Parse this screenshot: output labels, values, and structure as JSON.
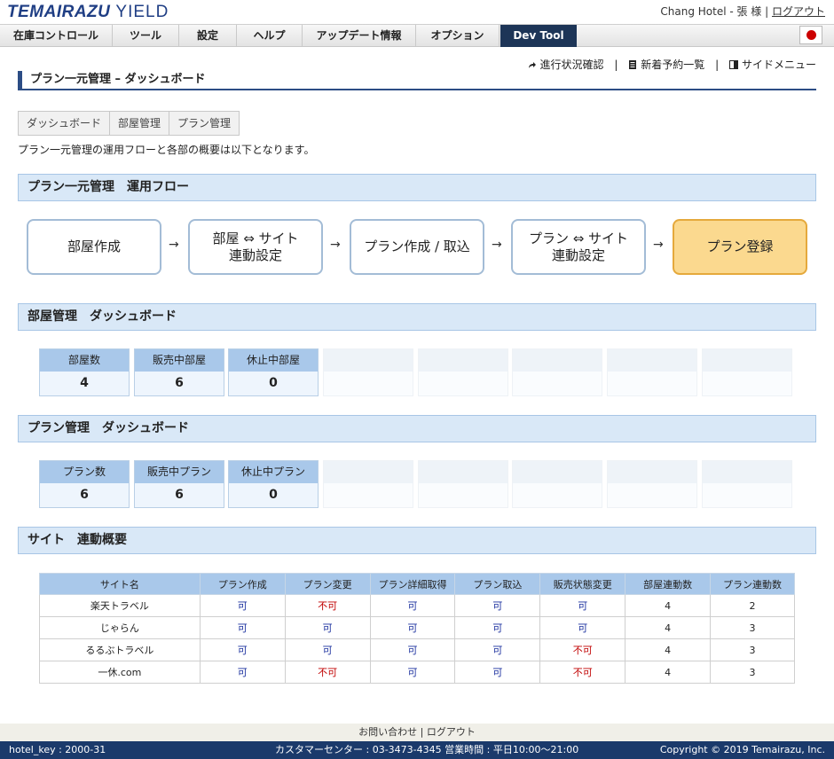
{
  "header": {
    "logo_main": "TEMAIRAZU",
    "logo_sub": "YIELD",
    "user_text": "Chang Hotel - 張 様",
    "logout_label": "ログアウト"
  },
  "nav": {
    "items": [
      "在庫コントロール",
      "ツール",
      "設定",
      "ヘルプ",
      "アップデート情報",
      "オプション",
      "Dev Tool"
    ]
  },
  "toplinks": {
    "progress": "進行状況確認",
    "new_reservations": "新着予約一覧",
    "side_menu": "サイドメニュー"
  },
  "page": {
    "title": "プラン一元管理 – ダッシュボード",
    "tabs": [
      "ダッシュボード",
      "部屋管理",
      "プラン管理"
    ],
    "intro": "プラン一元管理の運用フローと各部の概要は以下となります。"
  },
  "flow": {
    "heading": "プラン一元管理　運用フロー",
    "steps": [
      [
        "部屋作成"
      ],
      [
        "部屋 ⇔ サイト",
        "連動設定"
      ],
      [
        "プラン作成 / 取込"
      ],
      [
        "プラン ⇔ サイト",
        "連動設定"
      ],
      [
        "プラン登録"
      ]
    ],
    "arrow": "→"
  },
  "rooms": {
    "heading": "部屋管理　ダッシュボード",
    "stats": [
      {
        "label": "部屋数",
        "value": "4"
      },
      {
        "label": "販売中部屋",
        "value": "6"
      },
      {
        "label": "休止中部屋",
        "value": "0"
      }
    ]
  },
  "plans": {
    "heading": "プラン管理　ダッシュボード",
    "stats": [
      {
        "label": "プラン数",
        "value": "6"
      },
      {
        "label": "販売中プラン",
        "value": "6"
      },
      {
        "label": "休止中プラン",
        "value": "0"
      }
    ]
  },
  "sites": {
    "heading": "サイト　連動概要",
    "columns": [
      "サイト名",
      "プラン作成",
      "プラン変更",
      "プラン詳細取得",
      "プラン取込",
      "販売状態変更",
      "部屋連動数",
      "プラン連動数"
    ],
    "rows": [
      [
        "楽天トラベル",
        "可",
        "不可",
        "可",
        "可",
        "可",
        "4",
        "2"
      ],
      [
        "じゃらん",
        "可",
        "可",
        "可",
        "可",
        "可",
        "4",
        "3"
      ],
      [
        "るるぶトラベル",
        "可",
        "可",
        "可",
        "可",
        "不可",
        "4",
        "3"
      ],
      [
        "一休.com",
        "可",
        "不可",
        "可",
        "可",
        "不可",
        "4",
        "3"
      ]
    ]
  },
  "footer": {
    "contact": "お問い合わせ",
    "logout": "ログアウト",
    "hotel_key": "hotel_key : 2000-31",
    "center": "カスタマーセンター : 03-3473-4345 営業時間 : 平日10:00～21:00",
    "copyright": "Copyright © 2019 Temairazu, Inc."
  },
  "colors": {
    "brand": "#1f3e84",
    "section_bg": "#d9e8f7",
    "stat_label_bg": "#a9c8ea",
    "highlight": "#fbd98f",
    "ng_text": "#c00000",
    "ok_text": "#1a2f9e",
    "bottom_bar": "#1b3a6b"
  }
}
